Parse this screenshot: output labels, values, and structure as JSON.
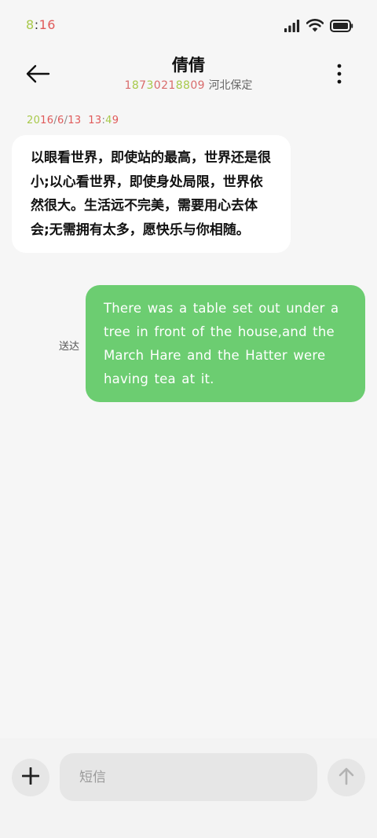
{
  "status_bar": {
    "time": "8:16",
    "time_chars": [
      {
        "char": "8",
        "color": "#a8c94a"
      },
      {
        "char": ":",
        "color": "#333333"
      },
      {
        "char": "1",
        "color": "#e05a5a"
      },
      {
        "char": "6",
        "color": "#e05a5a"
      }
    ],
    "signal_icon": "cellular-signal-icon",
    "wifi_icon": "wifi-icon",
    "battery_icon": "battery-icon"
  },
  "header": {
    "contact_name": "倩倩",
    "phone_chars": [
      {
        "char": "1",
        "color": "#d96b6b"
      },
      {
        "char": "8",
        "color": "#a8c94a"
      },
      {
        "char": "7",
        "color": "#d96b6b"
      },
      {
        "char": "3",
        "color": "#a8c94a"
      },
      {
        "char": "0",
        "color": "#d96b6b"
      },
      {
        "char": "2",
        "color": "#d96b6b"
      },
      {
        "char": "1",
        "color": "#d96b6b"
      },
      {
        "char": "8",
        "color": "#a8c94a"
      },
      {
        "char": "8",
        "color": "#a8c94a"
      },
      {
        "char": "0",
        "color": "#d96b6b"
      },
      {
        "char": "9",
        "color": "#d96b6b"
      }
    ],
    "phone": "18730218809",
    "location": "河北保定",
    "back_icon": "arrow-left-icon",
    "more_icon": "more-vertical-icon"
  },
  "conversation": {
    "timestamp": "2016/6/13 13:49",
    "timestamp_chars": [
      {
        "char": "2",
        "color": "#a8c94a"
      },
      {
        "char": "0",
        "color": "#a8c94a"
      },
      {
        "char": "1",
        "color": "#e05a5a"
      },
      {
        "char": "6",
        "color": "#e05a5a"
      },
      {
        "char": "/",
        "color": "#888888"
      },
      {
        "char": "6",
        "color": "#e05a5a"
      },
      {
        "char": "/",
        "color": "#888888"
      },
      {
        "char": "1",
        "color": "#e05a5a"
      },
      {
        "char": "3",
        "color": "#e05a5a"
      },
      {
        "char": " ",
        "color": "#888888"
      },
      {
        "char": " ",
        "color": "#888888"
      },
      {
        "char": "1",
        "color": "#e05a5a"
      },
      {
        "char": "3",
        "color": "#e05a5a"
      },
      {
        "char": ":",
        "color": "#888888"
      },
      {
        "char": "4",
        "color": "#a8c94a"
      },
      {
        "char": "9",
        "color": "#e05a5a"
      }
    ],
    "incoming_message": "以眼看世界，即使站的最高，世界还是很小;以心看世界，即使身处局限，世界依然很大。生活远不完美，需要用心去体会;无需拥有太多，愿快乐与你相随。",
    "outgoing_message": "There was a table set out under a tree in front of the house,and the March Hare and the Hatter were having tea at it.",
    "delivery_status": "送达",
    "colors": {
      "incoming_bubble": "#ffffff",
      "outgoing_bubble": "#6ccd71"
    }
  },
  "input_bar": {
    "placeholder": "短信",
    "value": "",
    "add_icon": "plus-icon",
    "send_icon": "arrow-up-icon"
  }
}
